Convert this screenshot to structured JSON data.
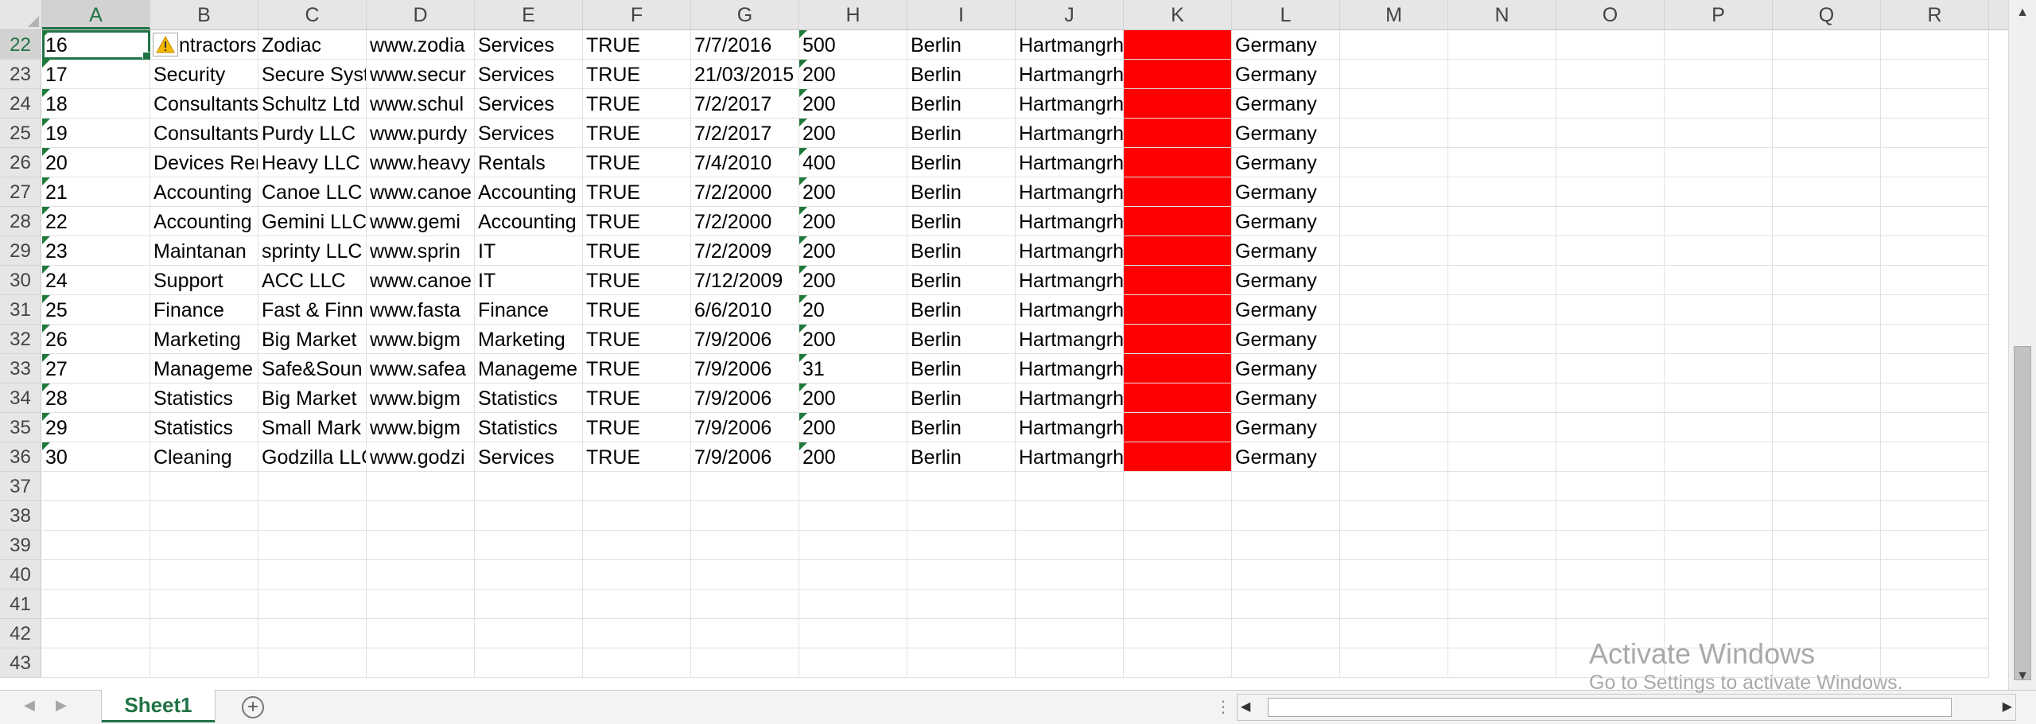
{
  "columns": [
    "A",
    "B",
    "C",
    "D",
    "E",
    "F",
    "G",
    "H",
    "I",
    "J",
    "K",
    "L",
    "M",
    "N",
    "O",
    "P",
    "Q",
    "R"
  ],
  "active_column": "A",
  "active_row": "22",
  "rows": [
    {
      "num": "22",
      "cells": [
        "16",
        "ntractors",
        "Zodiac",
        "www.zodia",
        "Services",
        "TRUE",
        "7/7/2016",
        "500",
        "Berlin",
        "Hartmangrh",
        "",
        "Germany",
        "",
        "",
        "",
        "",
        "",
        ""
      ]
    },
    {
      "num": "23",
      "cells": [
        "17",
        "Security",
        "Secure Syst",
        "www.secur",
        "Services",
        "TRUE",
        "21/03/2015",
        "200",
        "Berlin",
        "Hartmangrh",
        "",
        "Germany",
        "",
        "",
        "",
        "",
        "",
        ""
      ]
    },
    {
      "num": "24",
      "cells": [
        "18",
        "Consultants",
        "Schultz Ltd",
        "www.schul",
        "Services",
        "TRUE",
        "7/2/2017",
        "200",
        "Berlin",
        "Hartmangrh",
        "",
        "Germany",
        "",
        "",
        "",
        "",
        "",
        ""
      ]
    },
    {
      "num": "25",
      "cells": [
        "19",
        "Consultants",
        "Purdy LLC",
        "www.purdy",
        "Services",
        "TRUE",
        "7/2/2017",
        "200",
        "Berlin",
        "Hartmangrh",
        "",
        "Germany",
        "",
        "",
        "",
        "",
        "",
        ""
      ]
    },
    {
      "num": "26",
      "cells": [
        "20",
        "Devices Rer",
        "Heavy LLC",
        "www.heavy",
        "Rentals",
        "TRUE",
        "7/4/2010",
        "400",
        "Berlin",
        "Hartmangrh",
        "",
        "Germany",
        "",
        "",
        "",
        "",
        "",
        ""
      ]
    },
    {
      "num": "27",
      "cells": [
        "21",
        "Accounting",
        "Canoe LLC",
        "www.canoe",
        "Accounting",
        "TRUE",
        "7/2/2000",
        "200",
        "Berlin",
        "Hartmangrh",
        "",
        "Germany",
        "",
        "",
        "",
        "",
        "",
        ""
      ]
    },
    {
      "num": "28",
      "cells": [
        "22",
        "Accounting",
        "Gemini LLC",
        "www.gemi",
        "Accounting",
        "TRUE",
        "7/2/2000",
        "200",
        "Berlin",
        "Hartmangrh",
        "",
        "Germany",
        "",
        "",
        "",
        "",
        "",
        ""
      ]
    },
    {
      "num": "29",
      "cells": [
        "23",
        "Maintanan",
        "sprinty LLC",
        "www.sprin",
        "IT",
        "TRUE",
        "7/2/2009",
        "200",
        "Berlin",
        "Hartmangrh",
        "",
        "Germany",
        "",
        "",
        "",
        "",
        "",
        ""
      ]
    },
    {
      "num": "30",
      "cells": [
        "24",
        "Support",
        "ACC LLC",
        "www.canoe",
        "IT",
        "TRUE",
        "7/12/2009",
        "200",
        "Berlin",
        "Hartmangrh",
        "",
        "Germany",
        "",
        "",
        "",
        "",
        "",
        ""
      ]
    },
    {
      "num": "31",
      "cells": [
        "25",
        "Finance",
        "Fast & Finn",
        "www.fasta",
        "Finance",
        "TRUE",
        "6/6/2010",
        "20",
        "Berlin",
        "Hartmangrh",
        "",
        "Germany",
        "",
        "",
        "",
        "",
        "",
        ""
      ]
    },
    {
      "num": "32",
      "cells": [
        "26",
        "Marketing",
        "Big Market",
        "www.bigm",
        "Marketing",
        "TRUE",
        "7/9/2006",
        "200",
        "Berlin",
        "Hartmangrh",
        "",
        "Germany",
        "",
        "",
        "",
        "",
        "",
        ""
      ]
    },
    {
      "num": "33",
      "cells": [
        "27",
        "Manageme",
        "Safe&Soun",
        "www.safea",
        "Manageme",
        "TRUE",
        "7/9/2006",
        "31",
        "Berlin",
        "Hartmangrh",
        "",
        "Germany",
        "",
        "",
        "",
        "",
        "",
        ""
      ]
    },
    {
      "num": "34",
      "cells": [
        "28",
        "Statistics",
        "Big Market",
        "www.bigm",
        "Statistics",
        "TRUE",
        "7/9/2006",
        "200",
        "Berlin",
        "Hartmangrh",
        "",
        "Germany",
        "",
        "",
        "",
        "",
        "",
        ""
      ]
    },
    {
      "num": "35",
      "cells": [
        "29",
        "Statistics",
        "Small Mark",
        "www.bigm",
        "Statistics",
        "TRUE",
        "7/9/2006",
        "200",
        "Berlin",
        "Hartmangrh",
        "",
        "Germany",
        "",
        "",
        "",
        "",
        "",
        ""
      ]
    },
    {
      "num": "36",
      "cells": [
        "30",
        "Cleaning",
        "Godzilla LLC",
        "www.godzi",
        "Services",
        "TRUE",
        "7/9/2006",
        "200",
        "Berlin",
        "Hartmangrh",
        "",
        "Germany",
        "",
        "",
        "",
        "",
        "",
        ""
      ]
    },
    {
      "num": "37",
      "cells": [
        "",
        "",
        "",
        "",
        "",
        "",
        "",
        "",
        "",
        "",
        "",
        "",
        "",
        "",
        "",
        "",
        "",
        ""
      ]
    },
    {
      "num": "38",
      "cells": [
        "",
        "",
        "",
        "",
        "",
        "",
        "",
        "",
        "",
        "",
        "",
        "",
        "",
        "",
        "",
        "",
        "",
        ""
      ]
    },
    {
      "num": "39",
      "cells": [
        "",
        "",
        "",
        "",
        "",
        "",
        "",
        "",
        "",
        "",
        "",
        "",
        "",
        "",
        "",
        "",
        "",
        ""
      ]
    },
    {
      "num": "40",
      "cells": [
        "",
        "",
        "",
        "",
        "",
        "",
        "",
        "",
        "",
        "",
        "",
        "",
        "",
        "",
        "",
        "",
        "",
        ""
      ]
    },
    {
      "num": "41",
      "cells": [
        "",
        "",
        "",
        "",
        "",
        "",
        "",
        "",
        "",
        "",
        "",
        "",
        "",
        "",
        "",
        "",
        "",
        ""
      ]
    },
    {
      "num": "42",
      "cells": [
        "",
        "",
        "",
        "",
        "",
        "",
        "",
        "",
        "",
        "",
        "",
        "",
        "",
        "",
        "",
        "",
        "",
        ""
      ]
    },
    {
      "num": "43",
      "cells": [
        "",
        "",
        "",
        "",
        "",
        "",
        "",
        "",
        "",
        "",
        "",
        "",
        "",
        "",
        "",
        "",
        "",
        ""
      ]
    }
  ],
  "highlight_fill": "#ff0000",
  "accent_color": "#217346",
  "error_indicator_color": "#1f7a3a",
  "icons": {
    "warning": "warning-icon",
    "add_sheet": "plus-circle-icon"
  },
  "sheet_tab": "Sheet1",
  "add_sheet_symbol": "+",
  "watermark": {
    "title": "Activate Windows",
    "subtitle": "Go to Settings to activate Windows."
  }
}
